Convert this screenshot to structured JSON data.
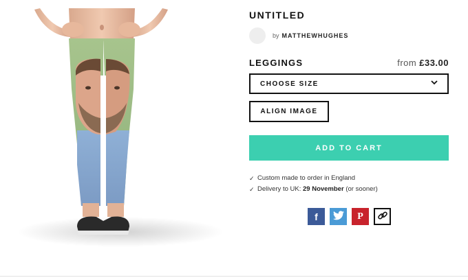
{
  "product": {
    "title": "UNTITLED",
    "author_prefix": "by",
    "author": "MATTHEWHUGHES",
    "type": "LEGGINGS",
    "price_prefix": "from",
    "price": "£33.00"
  },
  "actions": {
    "size_label": "CHOOSE SIZE",
    "align_label": "ALIGN IMAGE",
    "cart_label": "ADD TO CART"
  },
  "notes": {
    "line1": "Custom made to order in England",
    "line2_prefix": "Delivery to UK:",
    "line2_date": "29 November",
    "line2_suffix": "(or sooner)"
  },
  "share": {
    "facebook_glyph": "f",
    "pinterest_glyph": "P"
  },
  "colors": {
    "accent": "#3ccfb0",
    "facebook": "#3b5a98",
    "twitter": "#4b9bd6",
    "pinterest": "#c8232c"
  },
  "icons": [
    "chevron-down-icon",
    "check-icon",
    "facebook-icon",
    "twitter-icon",
    "pinterest-icon",
    "link-icon"
  ]
}
